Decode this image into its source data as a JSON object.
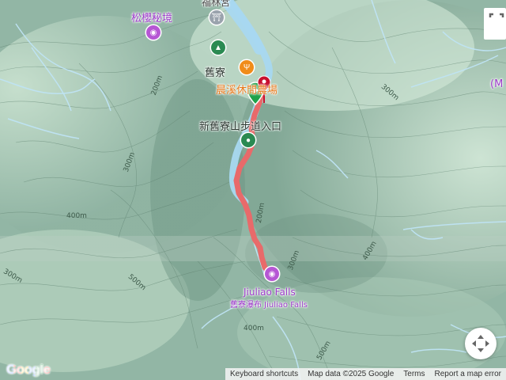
{
  "map": {
    "places": {
      "fulin_temple": "福林宮",
      "songying": "松櫻秘境",
      "jiuliao": "舊寮",
      "chenxi": "晨溪休閒農場",
      "trailhead": "新舊寮山步道入口",
      "falls_en": "Jiuliao Falls",
      "falls_full": "舊寮瀑布 Jiuliao Falls",
      "edge_right": "(M"
    },
    "elevations": {
      "e1": "200m",
      "e2": "300m",
      "e3": "300m",
      "e4": "400m",
      "e5": "200m",
      "e6": "300m",
      "e7": "400m",
      "e8": "300m",
      "e9": "500m",
      "e10": "400m",
      "e11": "500m"
    },
    "colors": {
      "route": "#e86a6a",
      "river": "#a8d8f0",
      "start_marker": "#1fa24a",
      "end_marker": "#c8102e",
      "temple_icon": "#9aa3ad",
      "attraction_icon": "#b657d4",
      "food_icon": "#f08c1a",
      "park_icon": "#2a8a52",
      "label_orange": "#e87a1c",
      "label_purple": "#9c3bc9"
    },
    "icons": {
      "temple": "temple-icon",
      "attraction": "camera-icon",
      "food": "restaurant-icon",
      "park": "tent-icon",
      "start": "start-flag-icon",
      "end": "end-pin-icon"
    }
  },
  "logo": {
    "text": "Google"
  },
  "attribution": {
    "keyboard": "Keyboard shortcuts",
    "mapdata": "Map data ©2025 Google",
    "terms": "Terms",
    "report": "Report a map error"
  }
}
